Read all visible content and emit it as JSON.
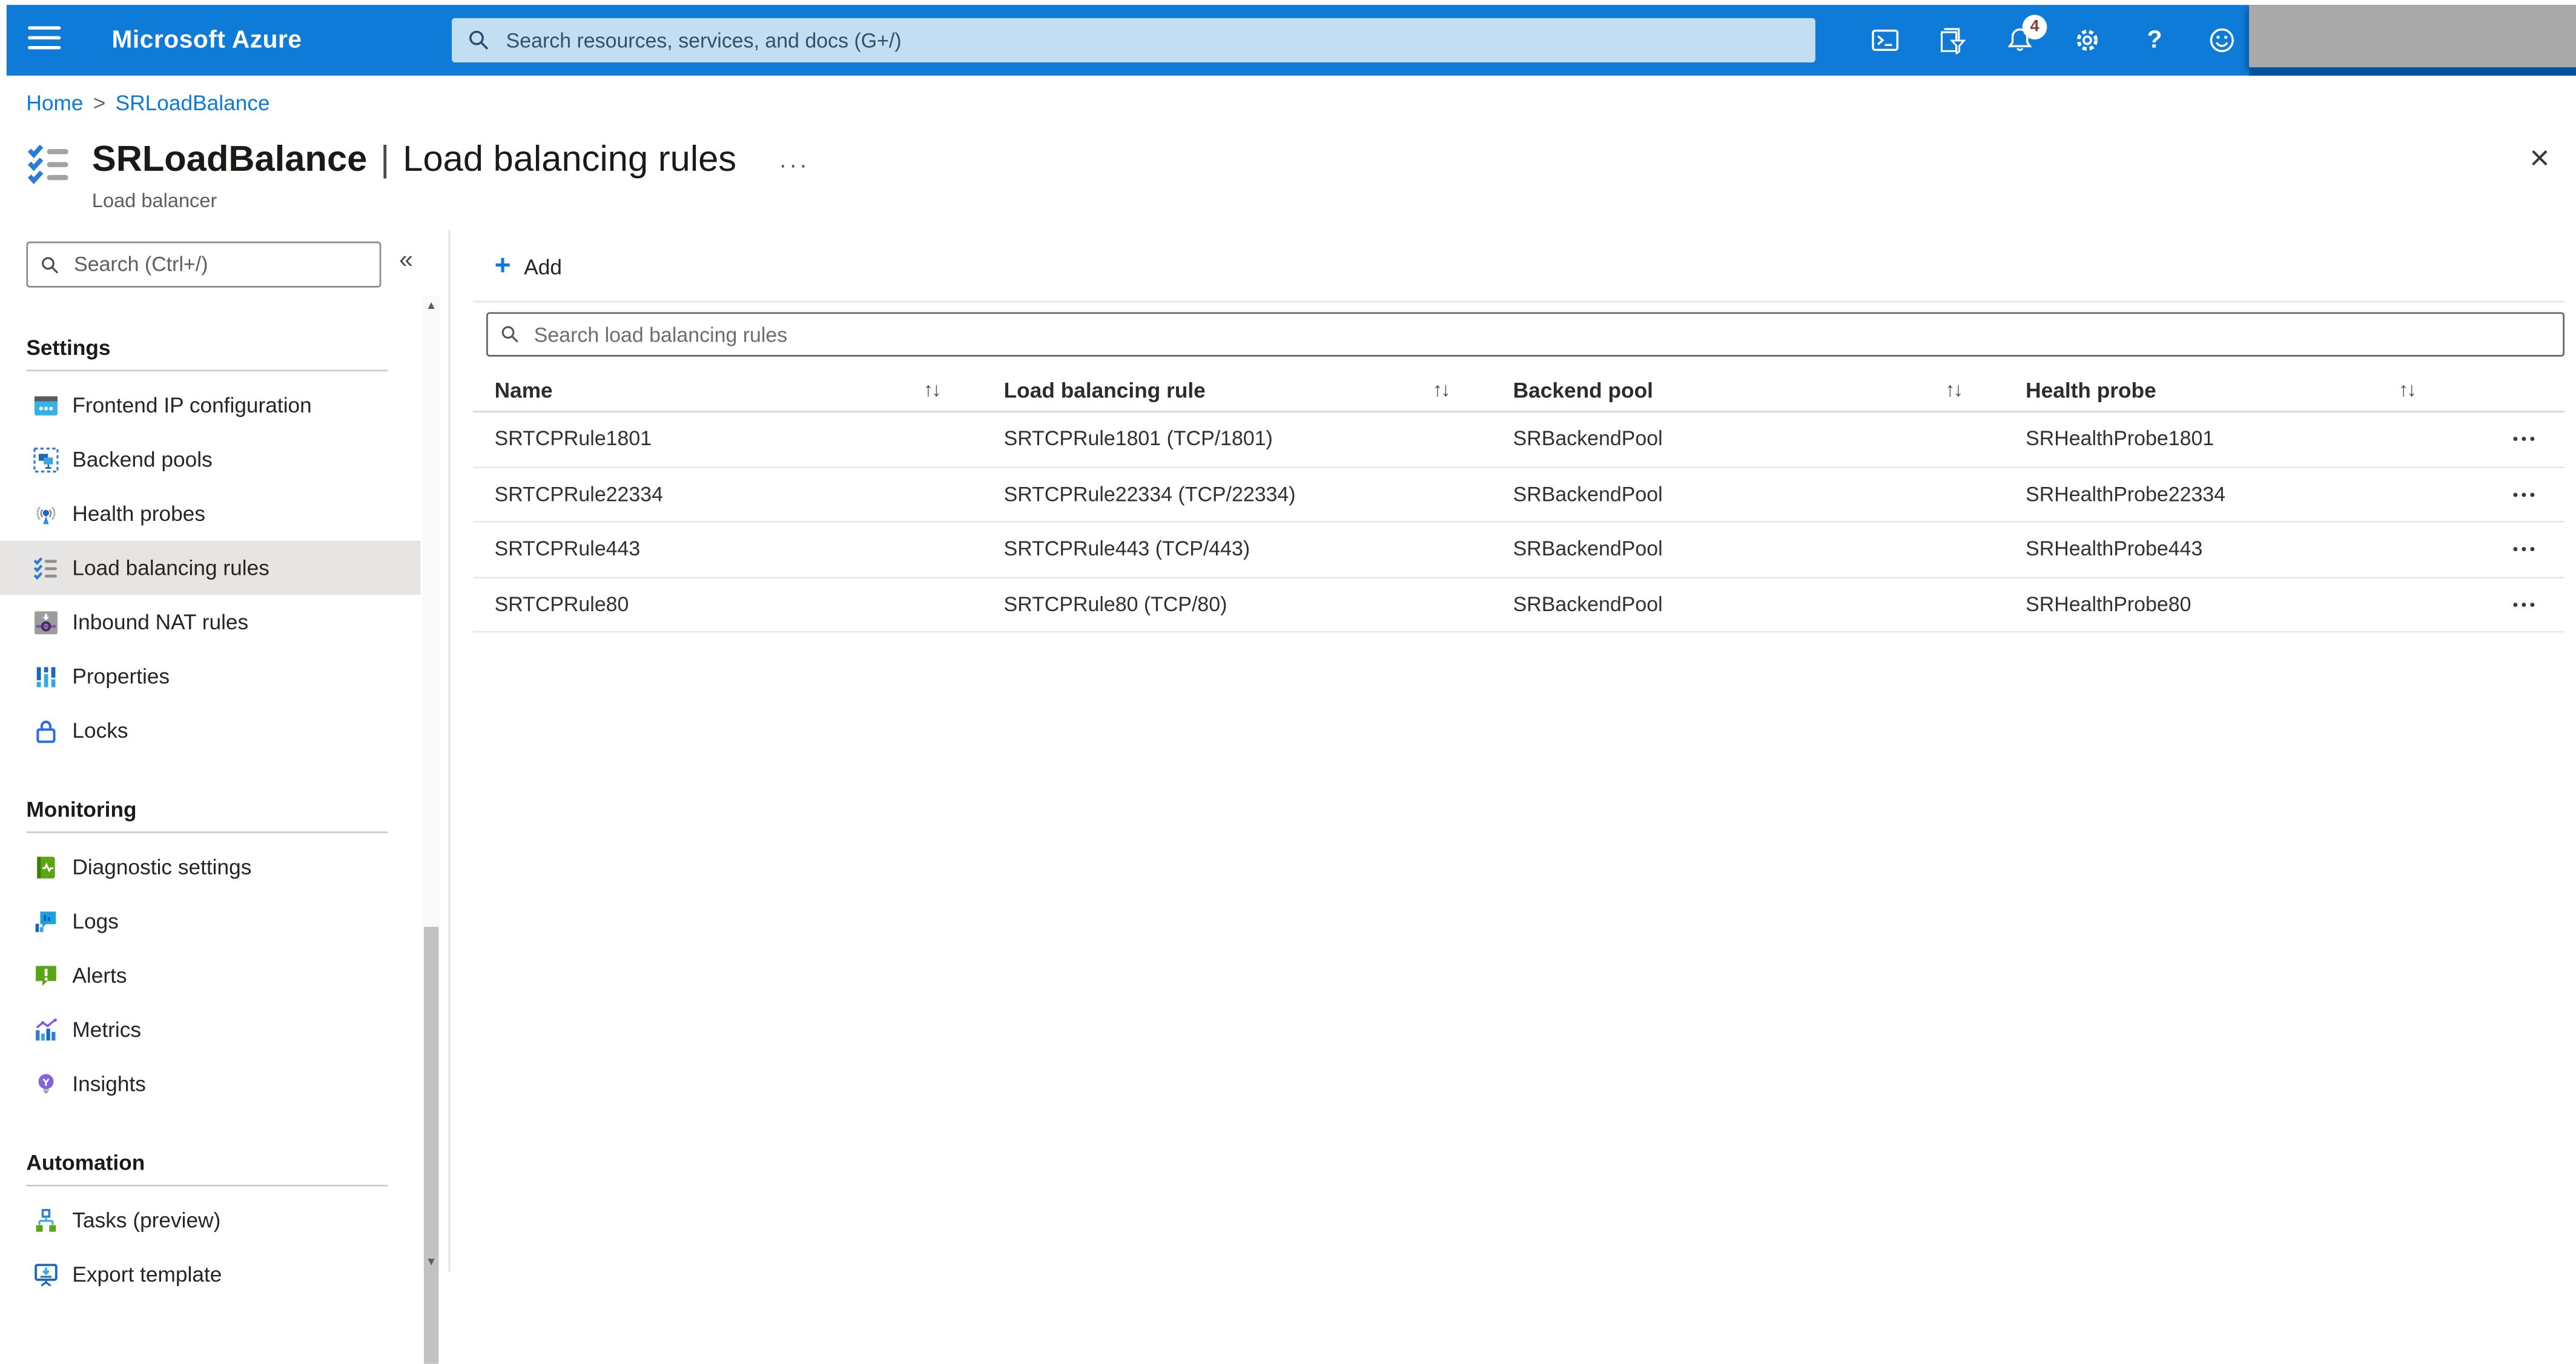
{
  "topbar": {
    "brand": "Microsoft Azure",
    "search_placeholder": "Search resources, services, and docs (G+/)",
    "notification_count": "4"
  },
  "breadcrumb": {
    "home": "Home",
    "separator": ">",
    "current": "SRLoadBalance"
  },
  "header": {
    "resource": "SRLoadBalance",
    "separator": "|",
    "blade": "Load balancing rules",
    "overflow": "···",
    "subtitle": "Load balancer",
    "close": "×"
  },
  "sidebar": {
    "search_placeholder": "Search (Ctrl+/)",
    "collapse_glyph": "«",
    "scroll_up_glyph": "▲",
    "scroll_down_glyph": "▼",
    "sections": [
      {
        "label": "Settings",
        "items": [
          {
            "label": "Frontend IP configuration"
          },
          {
            "label": "Backend pools"
          },
          {
            "label": "Health probes"
          },
          {
            "label": "Load balancing rules",
            "selected": true
          },
          {
            "label": "Inbound NAT rules"
          },
          {
            "label": "Properties"
          },
          {
            "label": "Locks"
          }
        ]
      },
      {
        "label": "Monitoring",
        "items": [
          {
            "label": "Diagnostic settings"
          },
          {
            "label": "Logs"
          },
          {
            "label": "Alerts"
          },
          {
            "label": "Metrics"
          },
          {
            "label": "Insights"
          }
        ]
      },
      {
        "label": "Automation",
        "items": [
          {
            "label": "Tasks (preview)"
          },
          {
            "label": "Export template"
          }
        ]
      }
    ]
  },
  "content": {
    "add_button": "Add",
    "search_placeholder": "Search load balancing rules",
    "table": {
      "columns": [
        "Name",
        "Load balancing rule",
        "Backend pool",
        "Health probe"
      ],
      "sort_glyph": "↑↓",
      "row_menu": "•••",
      "rows": [
        [
          "SRTCPRule1801",
          "SRTCPRule1801 (TCP/1801)",
          "SRBackendPool",
          "SRHealthProbe1801"
        ],
        [
          "SRTCPRule22334",
          "SRTCPRule22334 (TCP/22334)",
          "SRBackendPool",
          "SRHealthProbe22334"
        ],
        [
          "SRTCPRule443",
          "SRTCPRule443 (TCP/443)",
          "SRBackendPool",
          "SRHealthProbe443"
        ],
        [
          "SRTCPRule80",
          "SRTCPRule80 (TCP/80)",
          "SRBackendPool",
          "SRHealthProbe80"
        ]
      ]
    }
  },
  "colors": {
    "topbar_blue": "#0d7bd7",
    "accent_blue": "#0b7bd7",
    "topbar_search_bg": "#c3ddf3",
    "redaction_gray": "#a9a9a9",
    "redaction_strip": "#01539e",
    "badge_text": "#8f3a2e",
    "selected_item_bg": "#e6e5e4"
  }
}
